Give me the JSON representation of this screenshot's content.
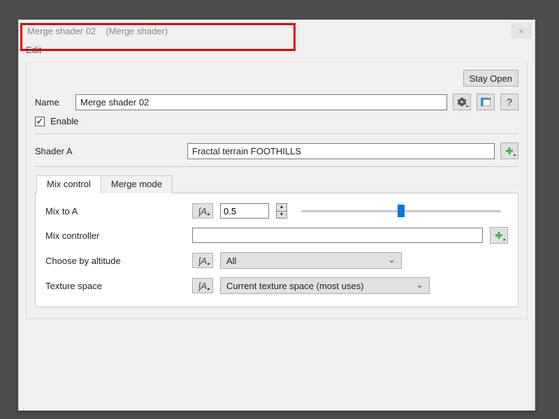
{
  "titlebar": {
    "node_name": "Merge shader 02",
    "node_type": "(Merge shader)",
    "close_glyph": "×"
  },
  "menubar": {
    "edit": "Edit"
  },
  "panel": {
    "stay_open": "Stay Open",
    "name_label": "Name",
    "name_value": "Merge shader 02",
    "enable_label": "Enable",
    "enable_checked": true,
    "shader_a_label": "Shader A",
    "shader_a_value": "Fractal terrain FOOTHILLS",
    "help_glyph": "?",
    "check_glyph": "✓"
  },
  "tabs": {
    "mix_control": "Mix control",
    "merge_mode": "Merge mode"
  },
  "mix": {
    "mix_to_a_label": "Mix to A",
    "mix_to_a_value": "0.5",
    "mix_slider_pos": 0.5,
    "mix_controller_label": "Mix controller",
    "mix_controller_value": "",
    "altitude_label": "Choose by altitude",
    "altitude_value": "All",
    "texture_space_label": "Texture space",
    "texture_space_value": "Current texture space (most uses)",
    "fa_glyph": "∫A"
  }
}
